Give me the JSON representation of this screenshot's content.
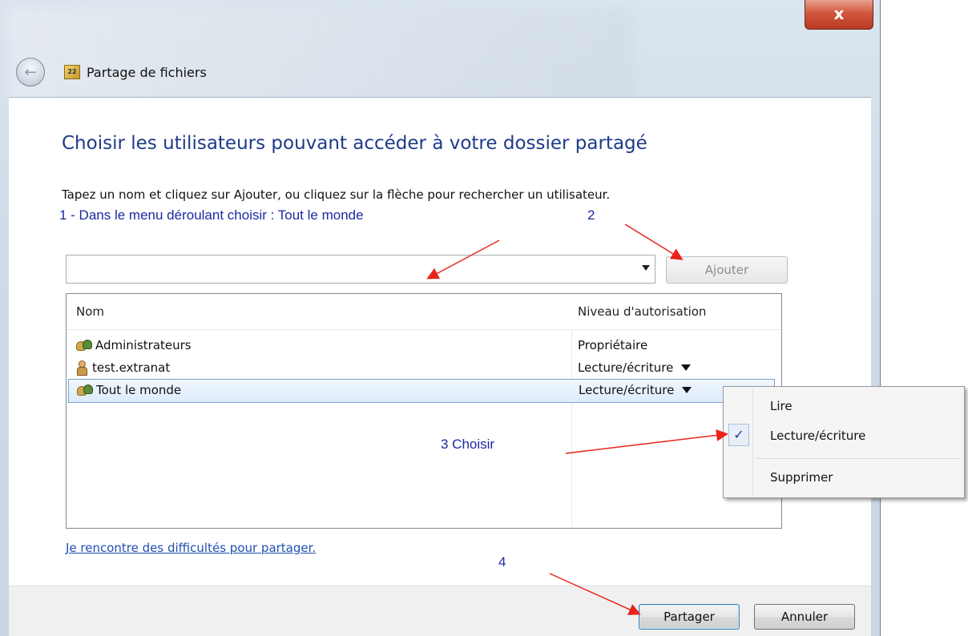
{
  "window": {
    "close_label": "x",
    "title": "Partage de fichiers",
    "app_icon_text": "22"
  },
  "main": {
    "heading": "Choisir les utilisateurs pouvant accéder à votre dossier partagé",
    "instruction": "Tapez un nom et cliquez sur Ajouter, ou cliquez sur la flèche pour rechercher un utilisateur.",
    "combo_value": "",
    "add_button": "Ajouter",
    "help_link": "Je rencontre des difficultés pour partager."
  },
  "list": {
    "headers": [
      "Nom",
      "Niveau d'autorisation"
    ],
    "rows": [
      {
        "name": "Administrateurs",
        "permission": "Propriétaire",
        "icon": "group-icon",
        "dropdown": false
      },
      {
        "name": "test.extranat",
        "permission": "Lecture/écriture",
        "icon": "user-icon",
        "dropdown": true
      },
      {
        "name": "Tout le monde",
        "permission": "Lecture/écriture",
        "icon": "group-icon",
        "dropdown": true,
        "selected": true
      }
    ]
  },
  "context_menu": {
    "items": [
      "Lire",
      "Lecture/écriture",
      "Supprimer"
    ],
    "checked": "Lecture/écriture",
    "check_glyph": "✓"
  },
  "annotations": {
    "step1": "1 - Dans le menu déroulant choisir : Tout le monde",
    "step2": "2",
    "step3": "3 Choisir",
    "step4": "4",
    "arrow_color": "#e8231c"
  },
  "footer": {
    "share_button": "Partager",
    "cancel_button": "Annuler"
  }
}
